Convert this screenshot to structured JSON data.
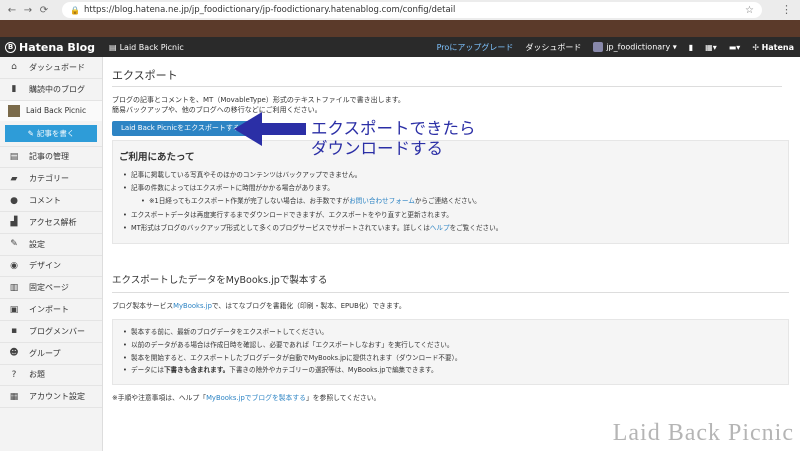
{
  "browser": {
    "url": "https://blog.hatena.ne.jp/jp_foodictionary/jp-foodictionary.hatenablog.com/config/detail",
    "back": "←",
    "forward": "→",
    "reload": "C"
  },
  "topbar": {
    "logo": "Hatena Blog",
    "blog_name": "Laid Back Picnic",
    "upgrade": "Proにアップグレード",
    "dashboard": "ダッシュボード",
    "user": "jp_foodictionary",
    "hatena": "Hatena"
  },
  "sidebar": {
    "dashboard": "ダッシュボード",
    "subscribed": "購読中のブログ",
    "blog_name": "Laid Back Picnic",
    "write": "記事を書く",
    "items": [
      "記事の管理",
      "カテゴリー",
      "コメント",
      "アクセス解析",
      "設定",
      "デザイン",
      "固定ページ",
      "インポート",
      "ブログメンバー",
      "グループ",
      "お題",
      "アカウント設定"
    ]
  },
  "main": {
    "title": "エクスポート",
    "desc_line1": "ブログの記事とコメントを、MT（MovableType）形式のテキストファイルで書き出します。",
    "desc_line2": "簡易バックアップや、他のブログへの移行などにご利用ください。",
    "export_button": "Laid Back Picnicをエクスポートする",
    "notice_title": "ご利用にあたって",
    "notice_items": {
      "i1": "記事に掲載している写真やそのほかのコンテンツはバックアップできません。",
      "i2": "記事の件数によってはエクスポートに時間がかかる場合があります。",
      "i3a": "※1日経ってもエクスポート作業が完了しない場合は、お手数ですが",
      "i3link": "お問い合わせフォーム",
      "i3b": "からご連絡ください。",
      "i4": "エクスポートデータは再度実行するまでダウンロードできますが、エクスポートをやり直すと更新されます。",
      "i5a": "MT形式はブログのバックアップ形式として多くのブログサービスでサポートされています。詳しくは",
      "i5link": "ヘルプ",
      "i5b": "をご覧ください。"
    },
    "sec2_title": "エクスポートしたデータをMyBooks.jpで製本する",
    "sec2_desc_a": "ブログ製本サービス",
    "sec2_desc_link": "MyBooks.jp",
    "sec2_desc_b": "で、はてなブログを書籍化（印刷・製本、EPUB化）できます。",
    "sec2_items": {
      "j1": "製本する前に、最新のブログデータをエクスポートしてください。",
      "j2": "以前のデータがある場合は作成日時を確認し、必要であれば「エクスポートしなおす」を実行してください。",
      "j3": "製本を開始すると、エクスポートしたブログデータが自動でMyBooks.jpに提供されます（ダウンロード不要）。",
      "j4a": "データには",
      "j4bold": "下書きも含まれます。",
      "j4b": "下書きの除外やカテゴリーの選択等は、MyBooks.jpで編集できます。"
    },
    "footnote_a": "※手順や注意事項は、ヘルプ「",
    "footnote_link": "MyBooks.jpでブログを製本する",
    "footnote_b": "」を参照してください。"
  },
  "annotation": {
    "line1": "エクスポートできたら",
    "line2": "ダウンロードする"
  },
  "watermark": "Laid Back Picnic"
}
